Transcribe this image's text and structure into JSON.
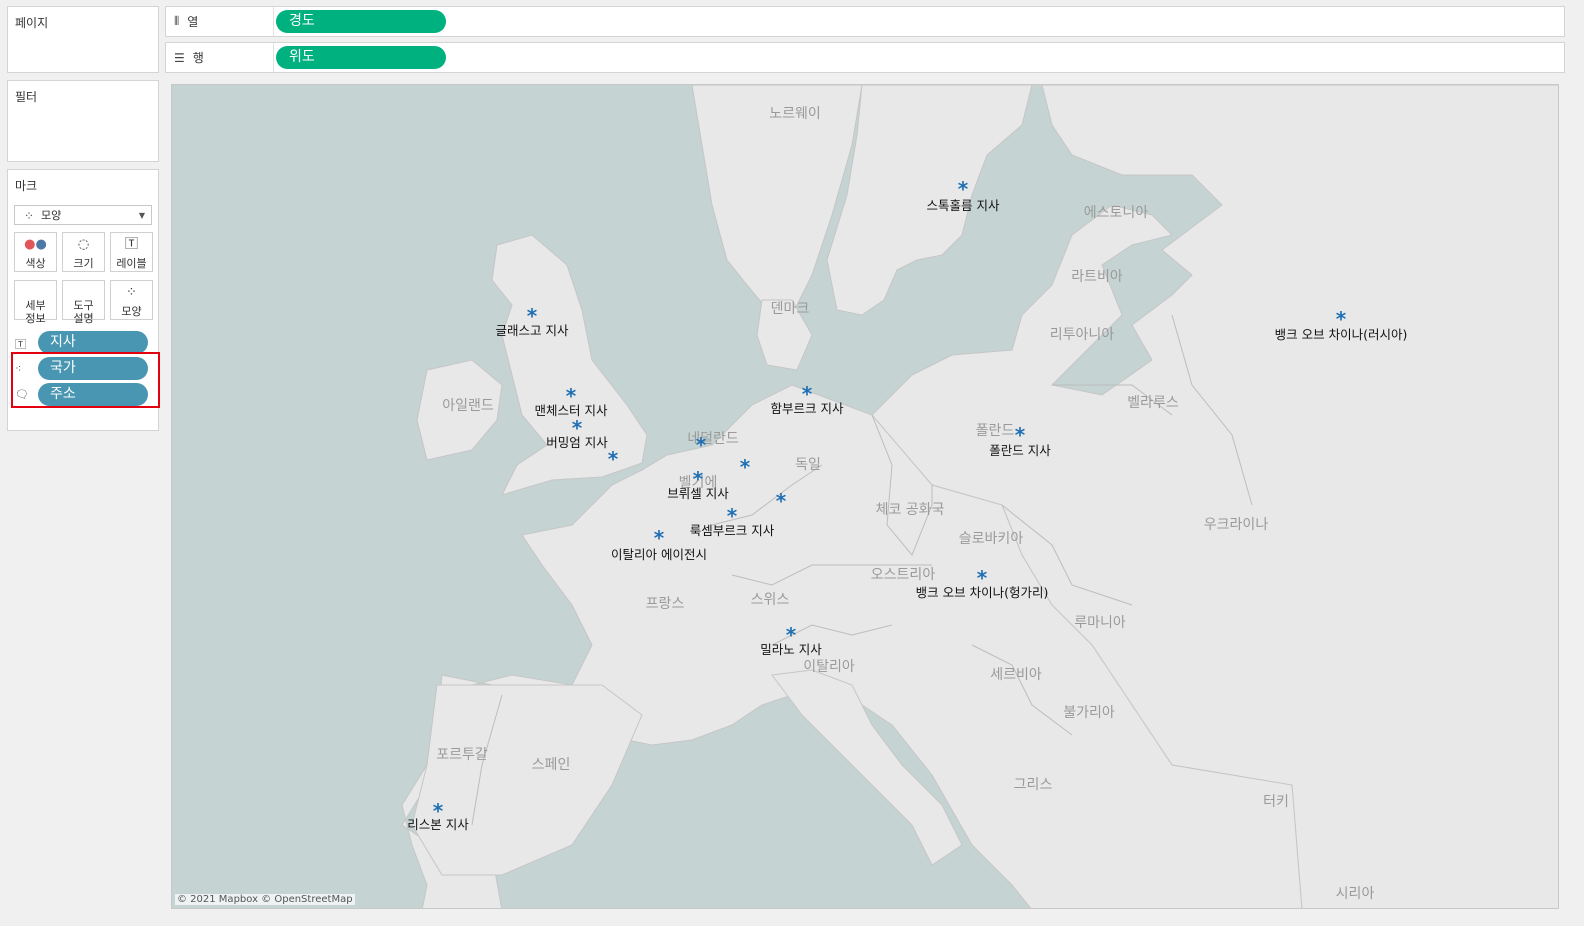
{
  "panels": {
    "pages": "페이지",
    "filters": "필터",
    "marks": "마크"
  },
  "shelves": {
    "columns": {
      "label": "열",
      "pill": "경도"
    },
    "rows": {
      "label": "행",
      "pill": "위도"
    }
  },
  "marks_card": {
    "mark_type": "모양",
    "buttons": [
      {
        "label": "색상",
        "icon": "color-icon"
      },
      {
        "label": "크기",
        "icon": "size-icon"
      },
      {
        "label": "레이블",
        "icon": "label-icon"
      },
      {
        "label": "세부\n정보",
        "icon": "detail-icon"
      },
      {
        "label": "도구\n설명",
        "icon": "tooltip-icon"
      },
      {
        "label": "모양",
        "icon": "shape-icon"
      }
    ],
    "fields": [
      {
        "name": "지사",
        "role": "label",
        "icon": "text-label-icon"
      },
      {
        "name": "국가",
        "role": "detail",
        "icon": "detail-dots-icon"
      },
      {
        "name": "주소",
        "role": "tooltip",
        "icon": "tooltip-bubble-icon"
      }
    ]
  },
  "map": {
    "attribution": "© 2021 Mapbox © OpenStreetMap",
    "colors": {
      "land": "#e8e8e8",
      "water": "#c5d3d3",
      "mark": "#1f6fb5"
    },
    "countries": [
      "노르웨이",
      "에스토니아",
      "라트비아",
      "덴마크",
      "리투아니아",
      "아일랜드",
      "벨라루스",
      "네덜란드",
      "폴란드",
      "독일",
      "벨기에",
      "체코 공화국",
      "우크라이나",
      "슬로바키아",
      "오스트리아",
      "프랑스",
      "스위스",
      "루마니아",
      "이탈리아",
      "세르비아",
      "불가리아",
      "포르투갈",
      "스페인",
      "그리스",
      "터키",
      "시리아"
    ],
    "branches": [
      "스톡홀름 지사",
      "글래스고 지사",
      "뱅크 오브 차이나(러시아)",
      "맨체스터 지사",
      "버밍엄 지사",
      "함부르크 지사",
      "폴란드 지사",
      "브뤼셀 지사",
      "룩셈부르크 지사",
      "이탈리아 에이전시",
      "뱅크 오브 차이나(헝가리)",
      "밀라노 지사",
      "리스본 지사"
    ]
  }
}
